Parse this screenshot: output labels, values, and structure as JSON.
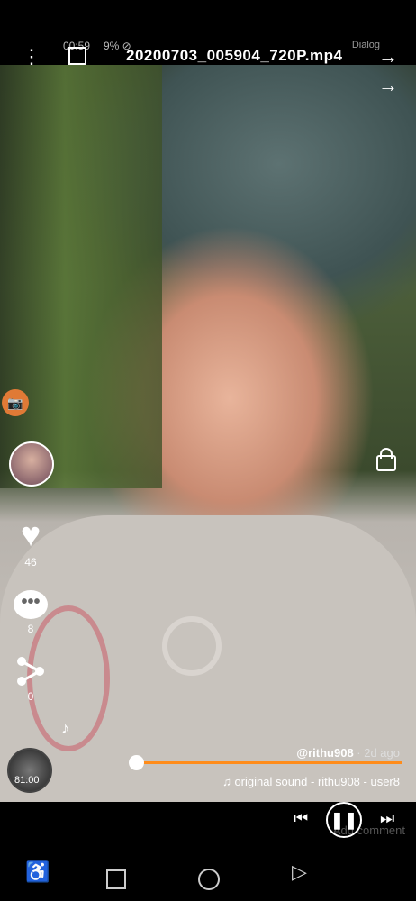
{
  "status_bar": {
    "mirrored_left": "00:59",
    "mirrored_extras": "9% ⊘",
    "right_text": "Dialog"
  },
  "title_bar": {
    "file_name": "20200703_005904_720P.mp4",
    "menu_icon": "more-vertical-icon",
    "crop_icon": "crop-icon",
    "close_icon": "arrow-icon"
  },
  "video": {
    "nav_arrow_icon": "arrow-icon",
    "lock_icon": "lock-icon"
  },
  "sidebar": {
    "camera_icon": "camera-icon",
    "likes_count": "46",
    "comments_count": "8",
    "shares_count": "0"
  },
  "info": {
    "handle": "@rithu908",
    "ago": " · 2d ago",
    "sound": "♫ original sound - rithu908 - user8",
    "time": "81:00"
  },
  "controls": {
    "progress": 0.0,
    "add_comment": "Add comment",
    "prev_icon": "skip-previous-icon",
    "pause_icon": "pause-icon",
    "next_icon": "skip-next-icon"
  },
  "colors": {
    "progress": "#ff8c1a",
    "camera_badge": "#e07a36"
  }
}
